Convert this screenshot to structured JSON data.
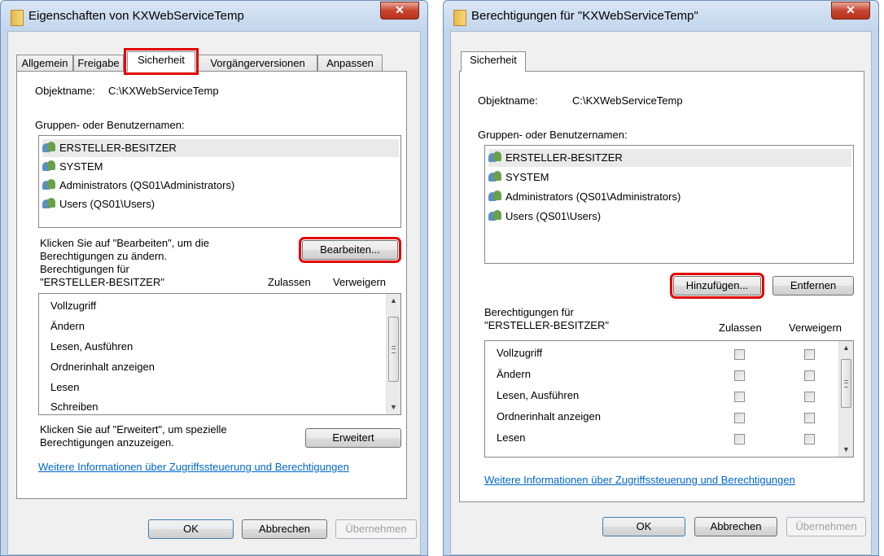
{
  "left": {
    "title": "Eigenschaften von KXWebServiceTemp",
    "tabs": [
      "Allgemein",
      "Freigabe",
      "Sicherheit",
      "Vorgängerversionen",
      "Anpassen"
    ],
    "object_label": "Objektname:",
    "object_value": "C:\\KXWebServiceTemp",
    "groups_label": "Gruppen- oder Benutzernamen:",
    "users": [
      "ERSTELLER-BESITZER",
      "SYSTEM",
      "Administrators (QS01\\Administrators)",
      "Users (QS01\\Users)"
    ],
    "edit_hint_1": "Klicken Sie auf \"Bearbeiten\", um die",
    "edit_hint_2": "Berechtigungen zu ändern.",
    "edit_button": "Bearbeiten...",
    "perm_for_1": "Berechtigungen für",
    "perm_for_2": "\"ERSTELLER-BESITZER\"",
    "col_allow": "Zulassen",
    "col_deny": "Verweigern",
    "permissions": [
      "Vollzugriff",
      "Ändern",
      "Lesen, Ausführen",
      "Ordnerinhalt anzeigen",
      "Lesen",
      "Schreiben"
    ],
    "adv_hint_1": "Klicken Sie auf \"Erweitert\", um spezielle",
    "adv_hint_2": "Berechtigungen anzuzeigen.",
    "advanced_button": "Erweitert",
    "more_info_link": "Weitere Informationen über Zugriffssteuerung und Berechtigungen",
    "ok": "OK",
    "cancel": "Abbrechen",
    "apply": "Übernehmen"
  },
  "right": {
    "title": "Berechtigungen für \"KXWebServiceTemp\"",
    "tab": "Sicherheit",
    "object_label": "Objektname:",
    "object_value": "C:\\KXWebServiceTemp",
    "groups_label": "Gruppen- oder Benutzernamen:",
    "users": [
      "ERSTELLER-BESITZER",
      "SYSTEM",
      "Administrators (QS01\\Administrators)",
      "Users (QS01\\Users)"
    ],
    "add_button": "Hinzufügen...",
    "remove_button": "Entfernen",
    "perm_for_1": "Berechtigungen für",
    "perm_for_2": "\"ERSTELLER-BESITZER\"",
    "col_allow": "Zulassen",
    "col_deny": "Verweigern",
    "permissions": [
      "Vollzugriff",
      "Ändern",
      "Lesen, Ausführen",
      "Ordnerinhalt anzeigen",
      "Lesen"
    ],
    "more_info_link": "Weitere Informationen über Zugriffssteuerung und Berechtigungen",
    "ok": "OK",
    "cancel": "Abbrechen",
    "apply": "Übernehmen"
  },
  "icons": {
    "close": "close-icon",
    "folder": "folder-icon",
    "user_group": "user-group-icon"
  },
  "colors": {
    "highlight": "#e00000",
    "link": "#0066cc",
    "selection": "#eaeaea"
  }
}
